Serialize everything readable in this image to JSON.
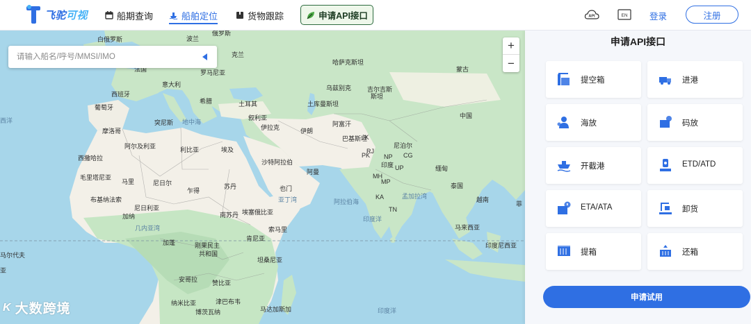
{
  "brand": {
    "name_part1": "飞驼",
    "name_part2": "可视"
  },
  "nav": {
    "schedule": "船期查询",
    "position": "船舶定位",
    "cargo": "货物跟踪",
    "api": "申请API接口"
  },
  "header": {
    "api_icon_label": "API",
    "lang_label": "EN",
    "login": "登录",
    "register": "注册"
  },
  "map": {
    "search_placeholder": "请输入船名/呼号/MMSI/IMO",
    "zoom_in": "+",
    "zoom_out": "−",
    "watermark": "大数跨境",
    "watermark_mark": "K",
    "labels": [
      "白俄罗斯",
      "波兰",
      "俄罗斯",
      "克兰",
      "罗马尼亚",
      "法国",
      "哈萨克斯坦",
      "蒙古",
      "意大利",
      "乌兹别克",
      "吉尔吉斯",
      "斯坦",
      "西班牙",
      "葡萄牙",
      "希腊",
      "土耳其",
      "土库曼斯坦",
      "地中海",
      "叙利亚",
      "伊拉克",
      "突尼斯",
      "阿富汗",
      "西洋",
      "摩洛哥",
      "伊朗",
      "中国",
      "巴基斯坦",
      "尼泊尔",
      "阿尔及利亚",
      "利比亚",
      "埃及",
      "西撒哈拉",
      "沙特阿拉伯",
      "印度",
      "缅甸",
      "阿曼",
      "毛里塔尼亚",
      "马里",
      "尼日尔",
      "苏丹",
      "乍得",
      "也门",
      "泰国",
      "阿拉伯海",
      "孟加拉湾",
      "布基纳法索",
      "尼日利亚",
      "埃塞俄比亚",
      "加纳",
      "南苏丹",
      "越南",
      "几内亚湾",
      "索马里",
      "马来西亚",
      "肯尼亚",
      "刚果民主",
      "共和国",
      "加蓬",
      "坦桑尼亚",
      "印度尼西亚",
      "安哥拉",
      "赞比亚",
      "纳米比亚",
      "津巴布韦",
      "马达加斯加",
      "博茨瓦纳",
      "印度洋",
      "亚丁湾",
      "印度洋",
      "菲",
      "马尔代夫",
      "亚",
      "JK",
      "PK",
      "NP",
      "RJ",
      "CG",
      "MH",
      "KA",
      "TN",
      "MP",
      "UP"
    ]
  },
  "panel": {
    "title": "申请API接口",
    "items": [
      {
        "label": "提空箱",
        "icon": "empty-container-pickup-icon"
      },
      {
        "label": "进港",
        "icon": "gate-in-truck-icon"
      },
      {
        "label": "海放",
        "icon": "customs-release-icon"
      },
      {
        "label": "码放",
        "icon": "terminal-release-icon"
      },
      {
        "label": "开截港",
        "icon": "port-cutoff-icon"
      },
      {
        "label": "ETD/ATD",
        "icon": "departure-icon"
      },
      {
        "label": "ETA/ATA",
        "icon": "arrival-icon"
      },
      {
        "label": "卸货",
        "icon": "unloading-icon"
      },
      {
        "label": "提箱",
        "icon": "container-pickup-icon"
      },
      {
        "label": "还箱",
        "icon": "container-return-icon"
      }
    ],
    "trial_button": "申请试用"
  },
  "colors": {
    "primary": "#2f6fe3",
    "sea": "#a7d6ea",
    "land_green": "#c6e6c4",
    "land_desert": "#f3f0e8",
    "api_border": "#2d6b3f"
  }
}
